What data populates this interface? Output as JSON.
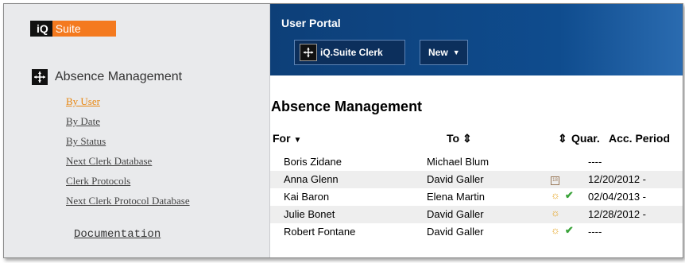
{
  "logo": {
    "part1": "iQ",
    "part2": "Suite"
  },
  "sidebar": {
    "section_title": "Absence Management",
    "items": [
      {
        "label": "By User",
        "active": true
      },
      {
        "label": "By Date"
      },
      {
        "label": "By Status"
      },
      {
        "label": "Next Clerk Database"
      },
      {
        "label": "Clerk Protocols"
      },
      {
        "label": "Next Clerk Protocol Database"
      }
    ],
    "documentation": "Documentation"
  },
  "header": {
    "portal_title": "User Portal",
    "clerk_button": "iQ.Suite Clerk",
    "new_button": "New"
  },
  "main": {
    "heading": "Absence Management",
    "columns": {
      "for": "For",
      "to": "To",
      "quar": "Quar.",
      "acc": "Acc. Period"
    },
    "rows": [
      {
        "for": "Boris Zidane",
        "to": "Michael Blum",
        "acc": "----",
        "icons": []
      },
      {
        "for": "Anna Glenn",
        "to": "David Galler",
        "acc": "12/20/2012 -",
        "icons": [
          "calendar-icon"
        ]
      },
      {
        "for": "Kai Baron",
        "to": "Elena Martin",
        "acc": "02/04/2013 -",
        "icons": [
          "sun-icon",
          "check-icon"
        ]
      },
      {
        "for": "Julie Bonet",
        "to": "David Galler",
        "acc": "12/28/2012 -",
        "icons": [
          "sun-icon"
        ]
      },
      {
        "for": "Robert Fontane",
        "to": "David Galler",
        "acc": "----",
        "icons": [
          "sun-icon",
          "check-icon"
        ]
      }
    ]
  },
  "colors": {
    "accent": "#f47a1f",
    "header_blue": "#0f4c8e",
    "active_link": "#e8860f"
  }
}
